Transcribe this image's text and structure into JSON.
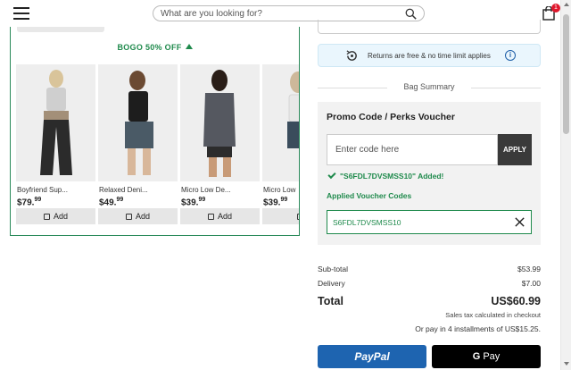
{
  "header": {
    "search_placeholder": "What are you looking for?",
    "bag_count": "1"
  },
  "carousel": {
    "title": "BOGO 50% OFF",
    "products": [
      {
        "name": "Boyfriend Sup...",
        "price_main": "$79.",
        "price_cents": "99",
        "add_label": "Add"
      },
      {
        "name": "Relaxed Deni...",
        "price_main": "$49.",
        "price_cents": "99",
        "add_label": "Add"
      },
      {
        "name": "Micro Low De...",
        "price_main": "$39.",
        "price_cents": "99",
        "add_label": "Add"
      },
      {
        "name": "Micro Low",
        "price_main": "$39.",
        "price_cents": "99",
        "add_label": ""
      }
    ]
  },
  "returns": {
    "text": "Returns are free & no time limit applies",
    "info_symbol": "i"
  },
  "bag_summary": {
    "title": "Bag Summary"
  },
  "promo": {
    "title": "Promo Code / Perks Voucher",
    "input_placeholder": "Enter code here",
    "apply_label": "APPLY",
    "added_message": "\"S6FDL7DVSMSS10\" Added!",
    "applied_title": "Applied Voucher Codes",
    "applied_code": "S6FDL7DVSMSS10"
  },
  "totals": {
    "subtotal_label": "Sub-total",
    "subtotal_value": "$53.99",
    "delivery_label": "Delivery",
    "delivery_value": "$7.00",
    "total_label": "Total",
    "total_value": "US$60.99",
    "tax_note": "Sales tax calculated in checkout",
    "installments": "Or pay in 4 installments of US$15.25."
  },
  "payments": {
    "paypal_label": "PayPal",
    "gpay_g": "G",
    "gpay_label": "Pay"
  }
}
